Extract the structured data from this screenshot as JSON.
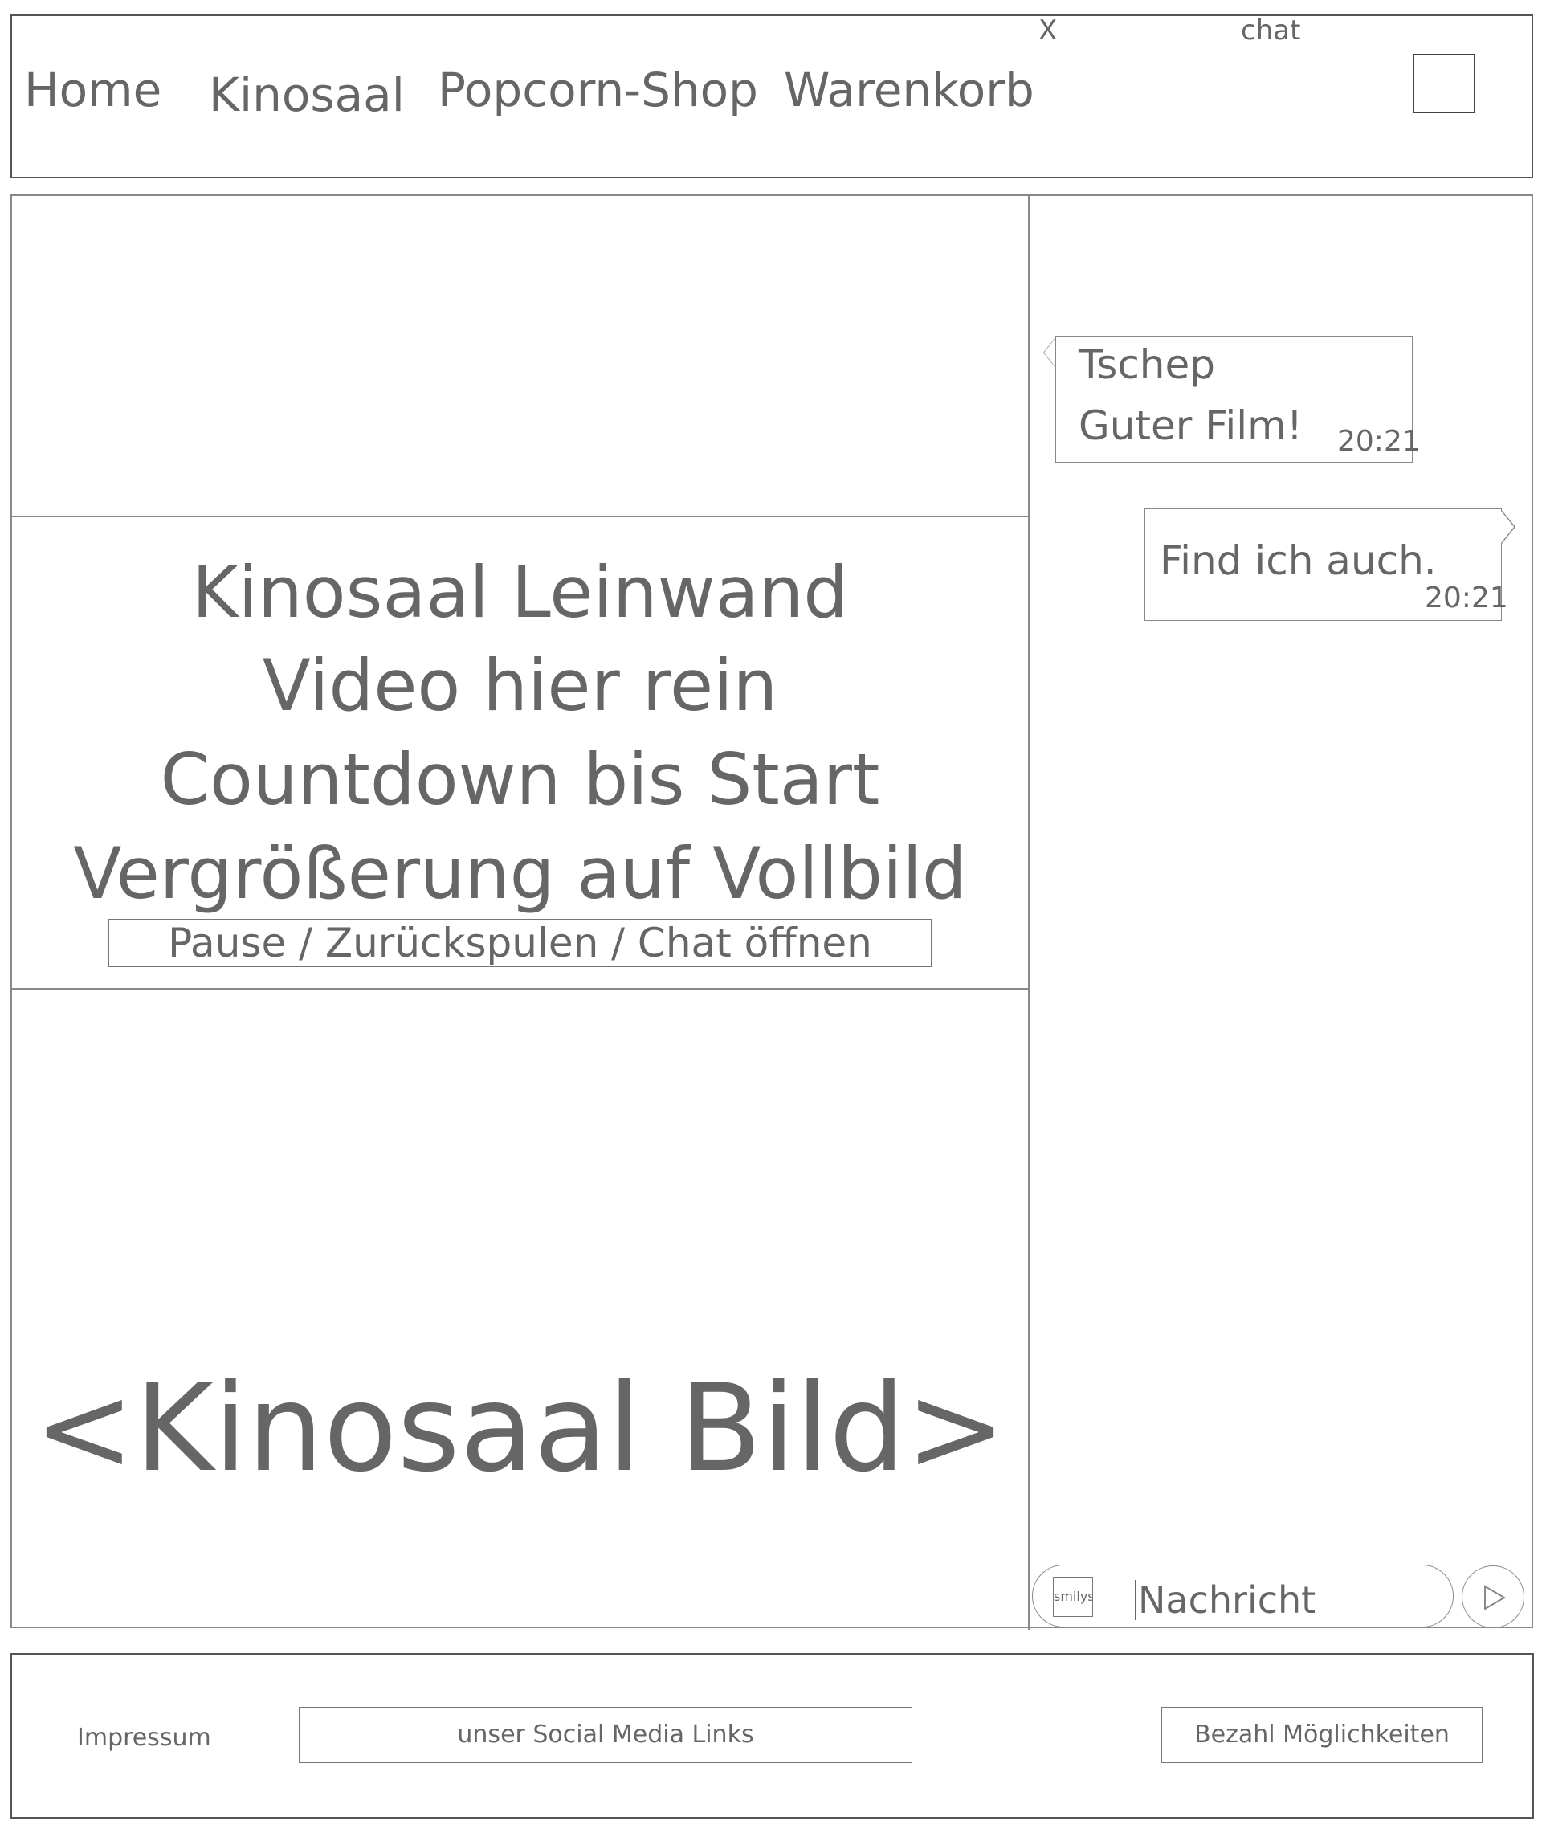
{
  "header": {
    "nav": [
      "Home",
      "Kinosaal",
      "Popcorn-Shop",
      "Warenkorb"
    ]
  },
  "screen": {
    "lines": [
      "Kinosaal Leinwand",
      "Video hier rein",
      "Countdown bis Start",
      "Vergrößerung auf Vollbild"
    ],
    "controls": "Pause / Zurückspulen / Chat öffnen",
    "image_placeholder": "<Kinosaal Bild>"
  },
  "chat": {
    "close": "X",
    "title": "chat",
    "messages": [
      {
        "sender": "Tschep",
        "text": "Guter Film!",
        "time": "20:21"
      },
      {
        "sender": "",
        "text": "Find ich auch.",
        "time": "20:21"
      }
    ],
    "smiley_label": "smilys",
    "input_placeholder": "Nachricht"
  },
  "footer": {
    "impressum": "Impressum",
    "social": "unser Social Media Links",
    "payment": "Bezahl Möglichkeiten"
  }
}
